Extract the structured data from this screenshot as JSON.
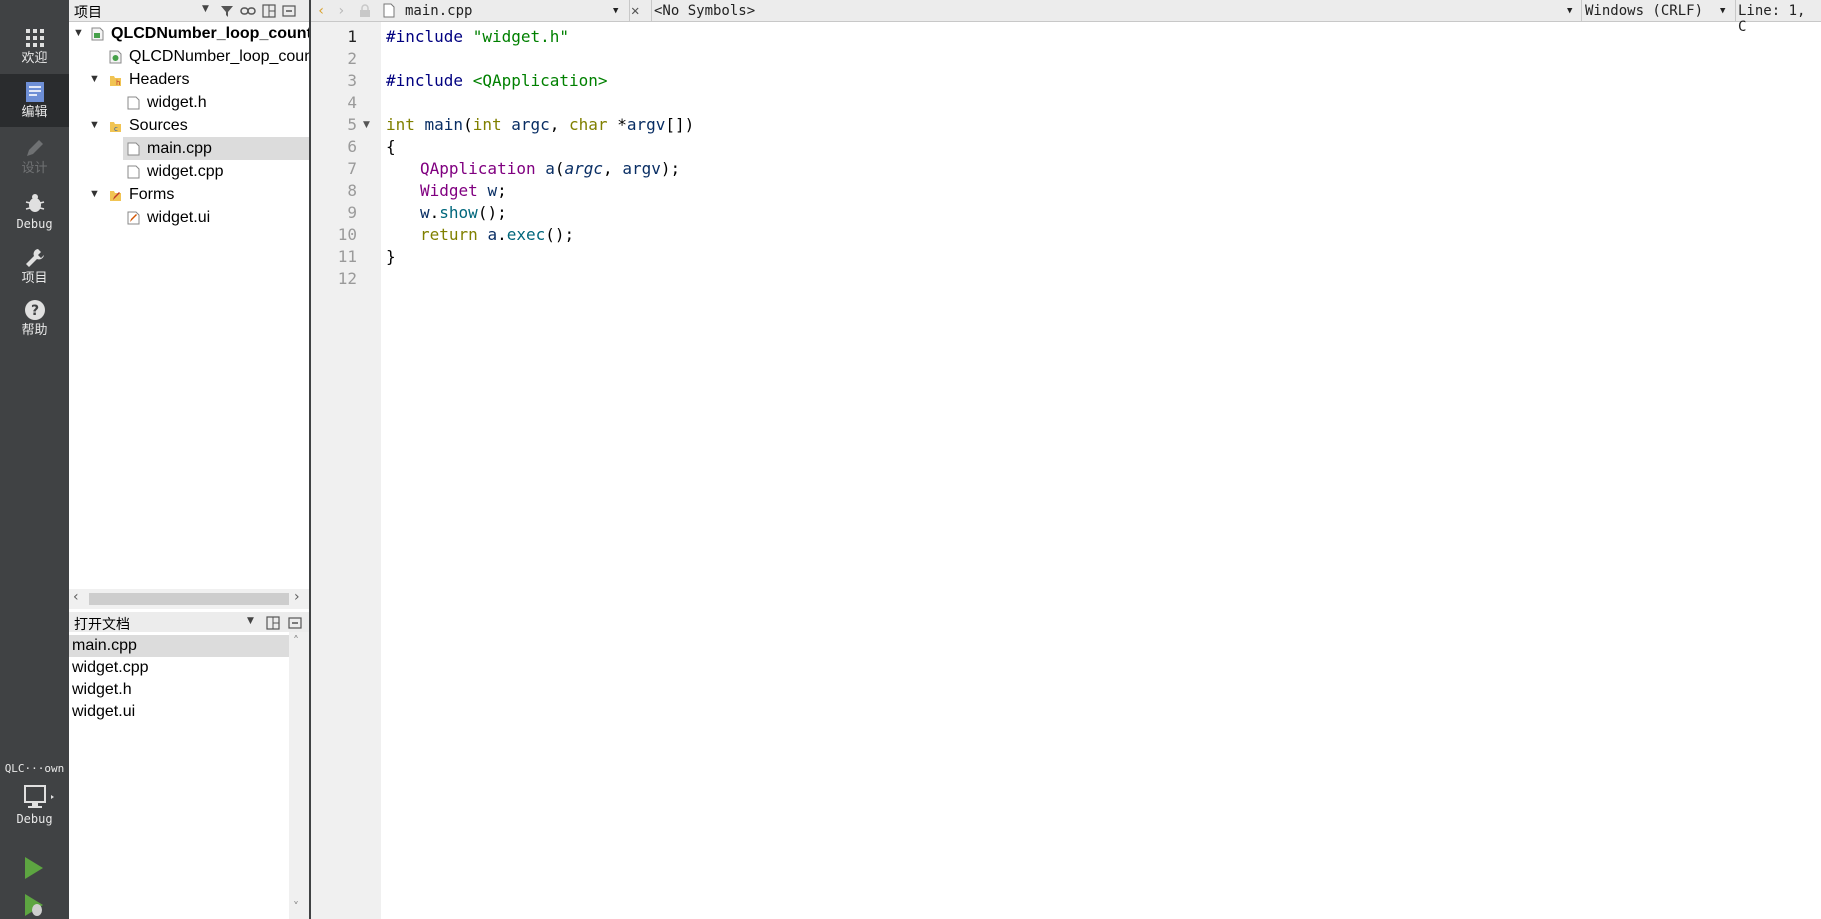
{
  "modebar": {
    "modes": [
      {
        "label": "欢迎",
        "icon": "grid-icon"
      },
      {
        "label": "编辑",
        "icon": "edit-document-icon"
      },
      {
        "label": "设计",
        "icon": "pencil-icon"
      },
      {
        "label": "Debug",
        "icon": "bug-icon"
      },
      {
        "label": "项目",
        "icon": "wrench-icon"
      },
      {
        "label": "帮助",
        "icon": "help-icon"
      }
    ],
    "kit_name": "QLC···own",
    "kit_build": "Debug"
  },
  "project_panel": {
    "title": "项目",
    "tree": [
      {
        "label": "QLCDNumber_loop_count",
        "icon": "project-icon"
      },
      {
        "label": "QLCDNumber_loop_count",
        "icon": "pro-file-icon"
      },
      {
        "label": "Headers",
        "icon": "headers-folder-icon"
      },
      {
        "label": "widget.h",
        "icon": "file-icon"
      },
      {
        "label": "Sources",
        "icon": "sources-folder-icon"
      },
      {
        "label": "main.cpp",
        "icon": "file-icon"
      },
      {
        "label": "widget.cpp",
        "icon": "file-icon"
      },
      {
        "label": "Forms",
        "icon": "forms-folder-icon"
      },
      {
        "label": "widget.ui",
        "icon": "ui-file-icon"
      }
    ]
  },
  "open_documents": {
    "title": "打开文档",
    "items": [
      "main.cpp",
      "widget.cpp",
      "widget.h",
      "widget.ui"
    ]
  },
  "editor": {
    "file_name": "main.cpp",
    "symbols": "<No Symbols>",
    "line_ending": "Windows (CRLF)",
    "position": "Line: 1, C",
    "line_numbers": [
      "1",
      "2",
      "3",
      "4",
      "5",
      "6",
      "7",
      "8",
      "9",
      "10",
      "11",
      "12"
    ],
    "code": {
      "l1_dir": "#include ",
      "l1_str": "\"widget.h\"",
      "l3_dir": "#include ",
      "l3_str": "<QApplication>",
      "l5_kw1": "int ",
      "l5_fn": "main",
      "l5_p1": "(",
      "l5_kw2": "int ",
      "l5_v1": "argc",
      "l5_p2": ", ",
      "l5_kw3": "char ",
      "l5_p3": "*",
      "l5_v2": "argv",
      "l5_p4": "[])",
      "l6": "{",
      "l7_ty": "QApplication ",
      "l7_v": "a",
      "l7_p1": "(",
      "l7_a1": "argc",
      "l7_p2": ", ",
      "l7_a2": "argv",
      "l7_p3": ");",
      "l8_ty": "Widget ",
      "l8_v": "w",
      "l8_p": ";",
      "l9_v": "w",
      "l9_p1": ".",
      "l9_fn": "show",
      "l9_p2": "();",
      "l10_kw": "return ",
      "l10_v": "a",
      "l10_p1": ".",
      "l10_fn": "exec",
      "l10_p2": "();",
      "l11": "}"
    }
  }
}
